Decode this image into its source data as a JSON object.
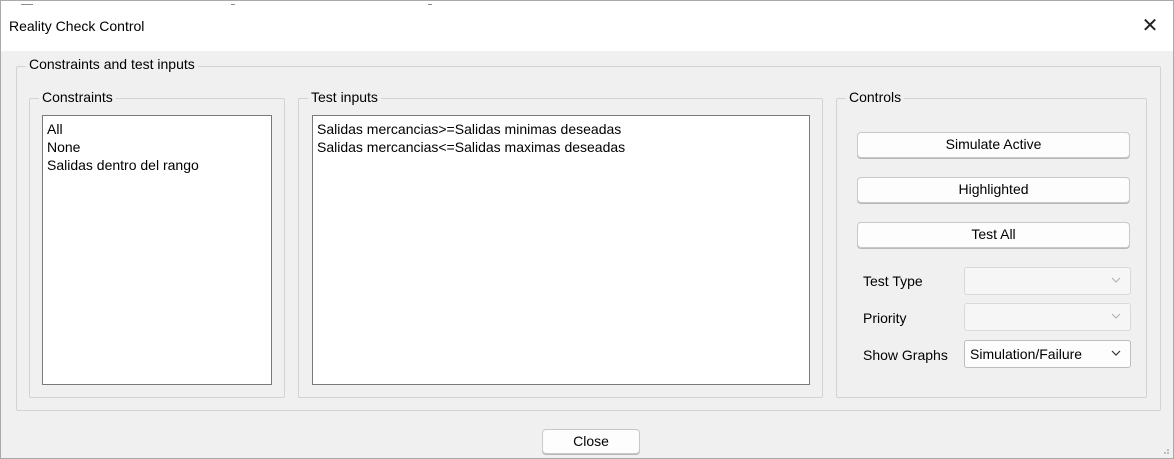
{
  "window": {
    "title": "Reality Check Control",
    "close_glyph": "✕"
  },
  "outer_group": {
    "label": "Constraints and test inputs"
  },
  "constraints": {
    "label": "Constraints",
    "items": [
      "All",
      "None",
      "Salidas dentro del rango"
    ]
  },
  "test_inputs": {
    "label": "Test inputs",
    "items": [
      "Salidas mercancias>=Salidas minimas deseadas",
      "Salidas mercancias<=Salidas maximas deseadas"
    ]
  },
  "controls": {
    "label": "Controls",
    "simulate_active_label": "Simulate Active",
    "highlighted_label": "Highlighted",
    "test_all_label": "Test All",
    "test_type_label": "Test Type",
    "test_type_value": "",
    "priority_label": "Priority",
    "priority_value": "",
    "show_graphs_label": "Show Graphs",
    "show_graphs_value": "Simulation/Failure"
  },
  "footer": {
    "close_label": "Close"
  },
  "icons": {
    "close": "close-icon",
    "chevron": "chevron-down-icon",
    "resize": "resize-grip-icon"
  }
}
